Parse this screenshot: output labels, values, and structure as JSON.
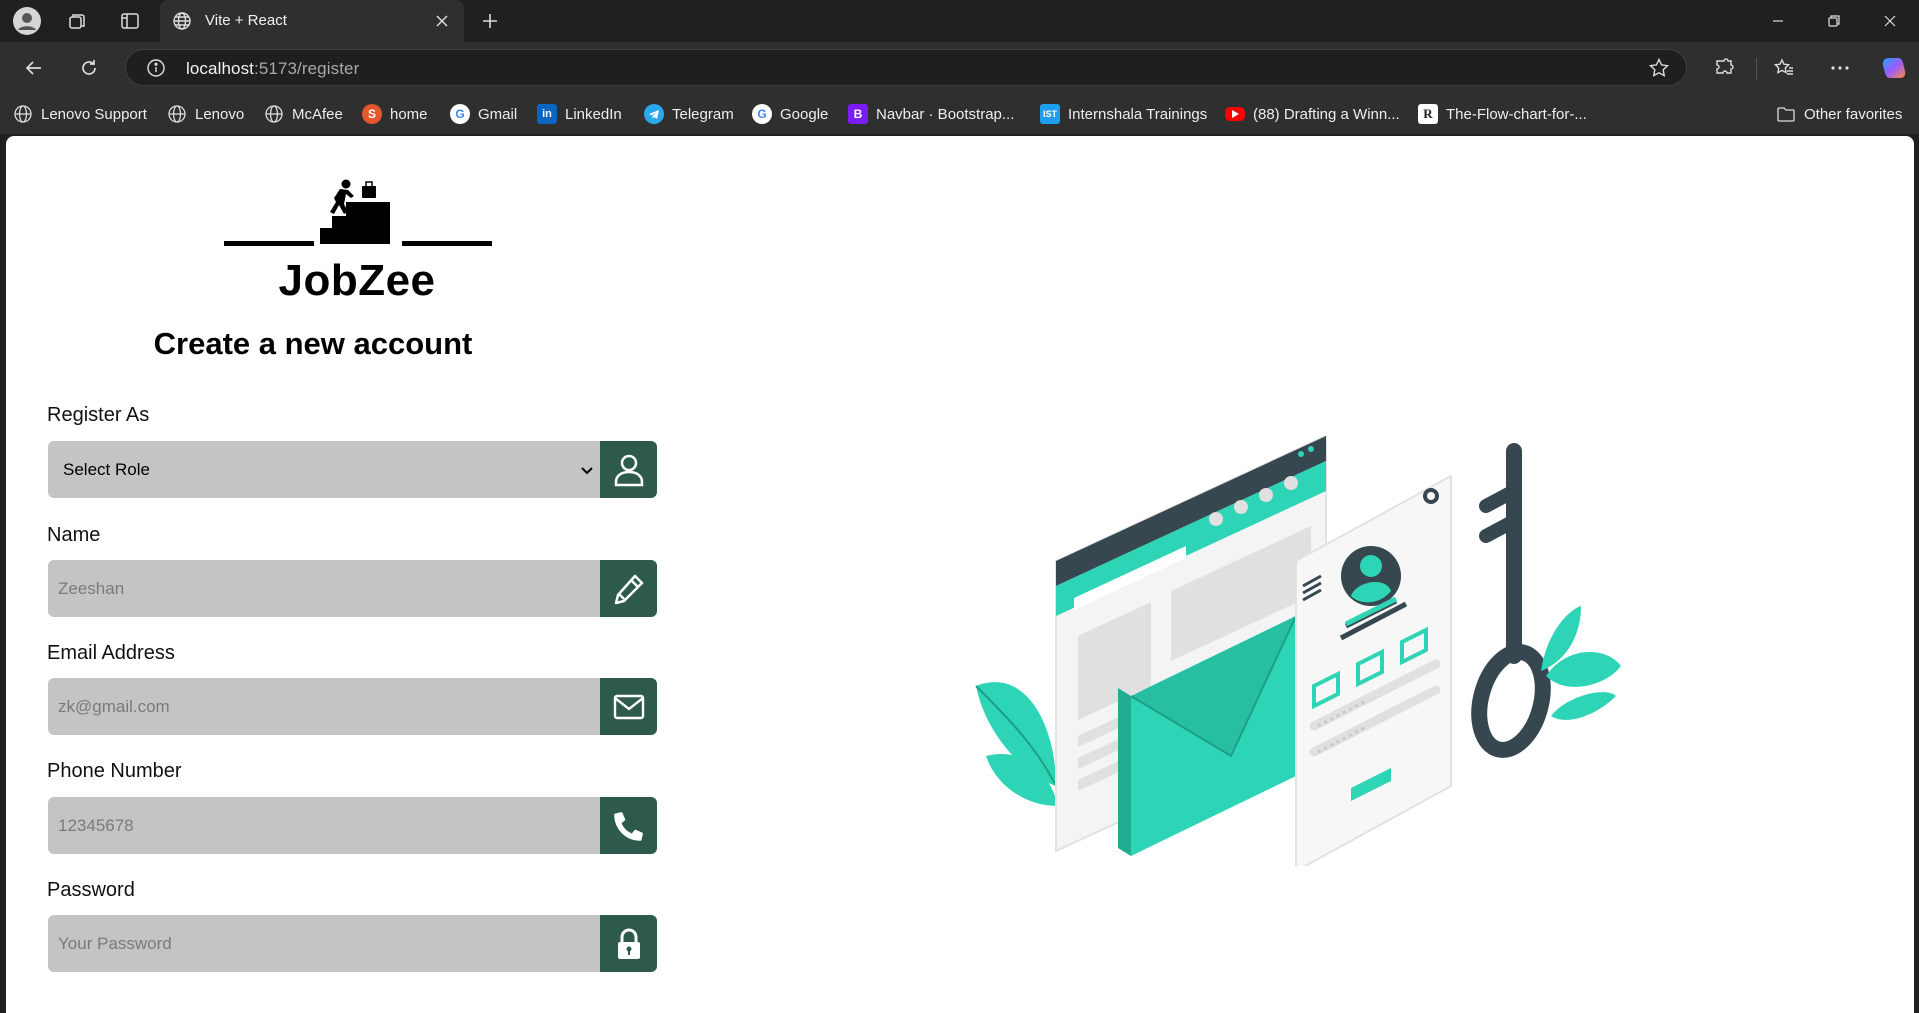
{
  "browser": {
    "tab_title": "Vite + React",
    "url_host": "localhost",
    "url_path": ":5173/register",
    "bookmarks": [
      {
        "label": "Lenovo Support",
        "icon": "globe-icon"
      },
      {
        "label": "Lenovo",
        "icon": "globe-icon"
      },
      {
        "label": "McAfee",
        "icon": "globe-icon"
      },
      {
        "label": "home",
        "icon": "home-site-icon"
      },
      {
        "label": "Gmail",
        "icon": "google-icon"
      },
      {
        "label": "LinkedIn",
        "icon": "linkedin-icon"
      },
      {
        "label": "Telegram",
        "icon": "telegram-icon"
      },
      {
        "label": "Google",
        "icon": "google-icon"
      },
      {
        "label": "Navbar · Bootstrap...",
        "icon": "bootstrap-icon"
      },
      {
        "label": "Internshala Trainings",
        "icon": "internshala-icon"
      },
      {
        "label": "(88) Drafting a Winn...",
        "icon": "youtube-icon"
      },
      {
        "label": "The-Flow-chart-for-...",
        "icon": "research-icon"
      }
    ],
    "other_favorites": "Other favorites"
  },
  "app": {
    "brand": "JobZee",
    "form_title": "Create a new account",
    "accent_color": "#2d5a4c",
    "fields": {
      "role": {
        "label": "Register As",
        "value": "Select Role",
        "icon": "user-icon"
      },
      "name": {
        "label": "Name",
        "placeholder": "Zeeshan",
        "icon": "pencil-icon"
      },
      "email": {
        "label": "Email Address",
        "placeholder": "zk@gmail.com",
        "icon": "mail-icon"
      },
      "phone": {
        "label": "Phone Number",
        "placeholder": "12345678",
        "icon": "phone-icon"
      },
      "password": {
        "label": "Password",
        "placeholder": "Your Password",
        "icon": "lock-icon"
      }
    }
  }
}
